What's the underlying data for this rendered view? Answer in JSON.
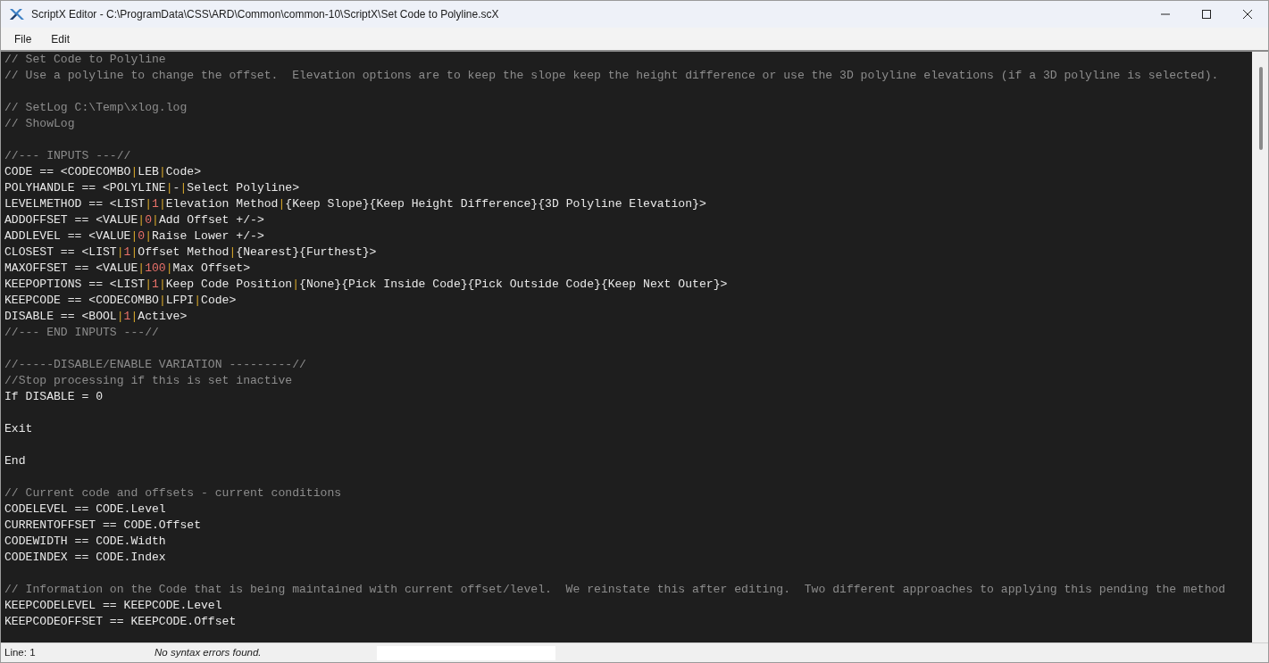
{
  "window": {
    "title": "ScriptX Editor - C:\\ProgramData\\CSS\\ARD\\Common\\common-10\\ScriptX\\Set Code to Polyline.scX"
  },
  "menu": [
    "File",
    "Edit"
  ],
  "editor": {
    "lines": [
      {
        "kind": "comment",
        "text": "// Set Code to Polyline"
      },
      {
        "kind": "comment",
        "text": "// Use a polyline to change the offset.  Elevation options are to keep the slope keep the height difference or use the 3D polyline elevations (if a 3D polyline is selected)."
      },
      {
        "kind": "blank"
      },
      {
        "kind": "comment",
        "text": "// SetLog C:\\Temp\\xlog.log"
      },
      {
        "kind": "comment",
        "text": "// ShowLog"
      },
      {
        "kind": "blank"
      },
      {
        "kind": "comment",
        "text": "//--- INPUTS ---//"
      },
      {
        "kind": "code",
        "segments": [
          {
            "kind": "text",
            "text": "CODE == <CODECOMBO"
          },
          {
            "kind": "sep",
            "text": "|"
          },
          {
            "kind": "text",
            "text": "LEB"
          },
          {
            "kind": "sep",
            "text": "|"
          },
          {
            "kind": "text",
            "text": "Code>"
          }
        ]
      },
      {
        "kind": "code",
        "segments": [
          {
            "kind": "text",
            "text": "POLYHANDLE == <POLYLINE"
          },
          {
            "kind": "sep",
            "text": "|"
          },
          {
            "kind": "text",
            "text": "-"
          },
          {
            "kind": "sep",
            "text": "|"
          },
          {
            "kind": "text",
            "text": "Select Polyline>"
          }
        ]
      },
      {
        "kind": "code",
        "segments": [
          {
            "kind": "text",
            "text": "LEVELMETHOD == <LIST"
          },
          {
            "kind": "sep",
            "text": "|"
          },
          {
            "kind": "num",
            "text": "1"
          },
          {
            "kind": "sep",
            "text": "|"
          },
          {
            "kind": "text",
            "text": "Elevation Method"
          },
          {
            "kind": "sep",
            "text": "|"
          },
          {
            "kind": "text",
            "text": "{Keep Slope}{Keep Height Difference}{3D Polyline Elevation}>"
          }
        ]
      },
      {
        "kind": "code",
        "segments": [
          {
            "kind": "text",
            "text": "ADDOFFSET == <VALUE"
          },
          {
            "kind": "sep",
            "text": "|"
          },
          {
            "kind": "num",
            "text": "0"
          },
          {
            "kind": "sep",
            "text": "|"
          },
          {
            "kind": "text",
            "text": "Add Offset +/->"
          }
        ]
      },
      {
        "kind": "code",
        "segments": [
          {
            "kind": "text",
            "text": "ADDLEVEL == <VALUE"
          },
          {
            "kind": "sep",
            "text": "|"
          },
          {
            "kind": "num",
            "text": "0"
          },
          {
            "kind": "sep",
            "text": "|"
          },
          {
            "kind": "text",
            "text": "Raise Lower +/->"
          }
        ]
      },
      {
        "kind": "code",
        "segments": [
          {
            "kind": "text",
            "text": "CLOSEST == <LIST"
          },
          {
            "kind": "sep",
            "text": "|"
          },
          {
            "kind": "num",
            "text": "1"
          },
          {
            "kind": "sep",
            "text": "|"
          },
          {
            "kind": "text",
            "text": "Offset Method"
          },
          {
            "kind": "sep",
            "text": "|"
          },
          {
            "kind": "text",
            "text": "{Nearest}{Furthest}>"
          }
        ]
      },
      {
        "kind": "code",
        "segments": [
          {
            "kind": "text",
            "text": "MAXOFFSET == <VALUE"
          },
          {
            "kind": "sep",
            "text": "|"
          },
          {
            "kind": "num",
            "text": "100"
          },
          {
            "kind": "sep",
            "text": "|"
          },
          {
            "kind": "text",
            "text": "Max Offset>"
          }
        ]
      },
      {
        "kind": "code",
        "segments": [
          {
            "kind": "text",
            "text": "KEEPOPTIONS == <LIST"
          },
          {
            "kind": "sep",
            "text": "|"
          },
          {
            "kind": "num",
            "text": "1"
          },
          {
            "kind": "sep",
            "text": "|"
          },
          {
            "kind": "text",
            "text": "Keep Code Position"
          },
          {
            "kind": "sep",
            "text": "|"
          },
          {
            "kind": "text",
            "text": "{None}{Pick Inside Code}{Pick Outside Code}{Keep Next Outer}>"
          }
        ]
      },
      {
        "kind": "code",
        "segments": [
          {
            "kind": "text",
            "text": "KEEPCODE == <CODECOMBO"
          },
          {
            "kind": "sep",
            "text": "|"
          },
          {
            "kind": "text",
            "text": "LFPI"
          },
          {
            "kind": "sep",
            "text": "|"
          },
          {
            "kind": "text",
            "text": "Code>"
          }
        ]
      },
      {
        "kind": "code",
        "segments": [
          {
            "kind": "text",
            "text": "DISABLE == <BOOL"
          },
          {
            "kind": "sep",
            "text": "|"
          },
          {
            "kind": "num",
            "text": "1"
          },
          {
            "kind": "sep",
            "text": "|"
          },
          {
            "kind": "text",
            "text": "Active>"
          }
        ]
      },
      {
        "kind": "comment",
        "text": "//--- END INPUTS ---//"
      },
      {
        "kind": "blank"
      },
      {
        "kind": "comment",
        "text": "//-----DISABLE/ENABLE VARIATION ---------//"
      },
      {
        "kind": "comment",
        "text": "//Stop processing if this is set inactive"
      },
      {
        "kind": "plain",
        "text": "If DISABLE = 0"
      },
      {
        "kind": "blank"
      },
      {
        "kind": "plain",
        "text": "Exit"
      },
      {
        "kind": "blank"
      },
      {
        "kind": "plain",
        "text": "End"
      },
      {
        "kind": "blank"
      },
      {
        "kind": "comment",
        "text": "// Current code and offsets - current conditions"
      },
      {
        "kind": "plain",
        "text": "CODELEVEL == CODE.Level"
      },
      {
        "kind": "plain",
        "text": "CURRENTOFFSET == CODE.Offset"
      },
      {
        "kind": "plain",
        "text": "CODEWIDTH == CODE.Width"
      },
      {
        "kind": "plain",
        "text": "CODEINDEX == CODE.Index"
      },
      {
        "kind": "blank"
      },
      {
        "kind": "comment",
        "text": "// Information on the Code that is being maintained with current offset/level.  We reinstate this after editing.  Two different approaches to applying this pending the method"
      },
      {
        "kind": "plain",
        "text": "KEEPCODELEVEL == KEEPCODE.Level"
      },
      {
        "kind": "plain",
        "text": "KEEPCODEOFFSET == KEEPCODE.Offset"
      }
    ]
  },
  "status_bar": {
    "line": "Line: 1",
    "message": "No syntax errors found."
  }
}
